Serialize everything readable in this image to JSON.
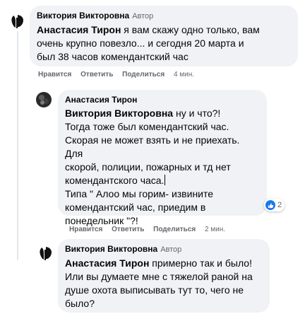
{
  "comments": [
    {
      "author": "Виктория Викторовна",
      "badge": "Автор",
      "mention": "Анастасия Тирон",
      "text_lines": [
        " я вам скажу одно только, вам",
        "очень крупно повезло... и сегодня 20 марта и",
        "был 38 часов комендантский час"
      ],
      "actions": {
        "like": "Нравится",
        "reply": "Ответить",
        "share": "Поделиться",
        "time": "4 мин."
      }
    },
    {
      "author": "Анастасия Тирон",
      "mention": "Виктория Викторовна",
      "text_lines": [
        " ну и что?!",
        "Тогда тоже был комендантский час.",
        "Скорая не может взять и не приехать. Для",
        "скорой, полиции, пожарных и тд нет",
        "комендантского часа.",
        "Типа \" Алоо мы горим- извините",
        "комендантский час, приедим в",
        "понедельник \"?!"
      ],
      "actions": {
        "like": "Нравится",
        "reply": "Ответить",
        "share": "Поделиться",
        "time": "2 мин."
      },
      "reaction_count": "2",
      "reaction_icon": "like-icon"
    },
    {
      "author": "Виктория Викторовна",
      "badge": "Автор",
      "mention": "Анастасия Тирон",
      "text_lines": [
        " примерно так и было!",
        "Или вы думаете мне с тяжелой раной на",
        "душе охота выписывать тут то, чего не",
        "было?"
      ]
    }
  ],
  "colors": {
    "bubble": "#f0f2f5",
    "secondary_text": "#65676b",
    "like_blue": "#1877f2"
  }
}
